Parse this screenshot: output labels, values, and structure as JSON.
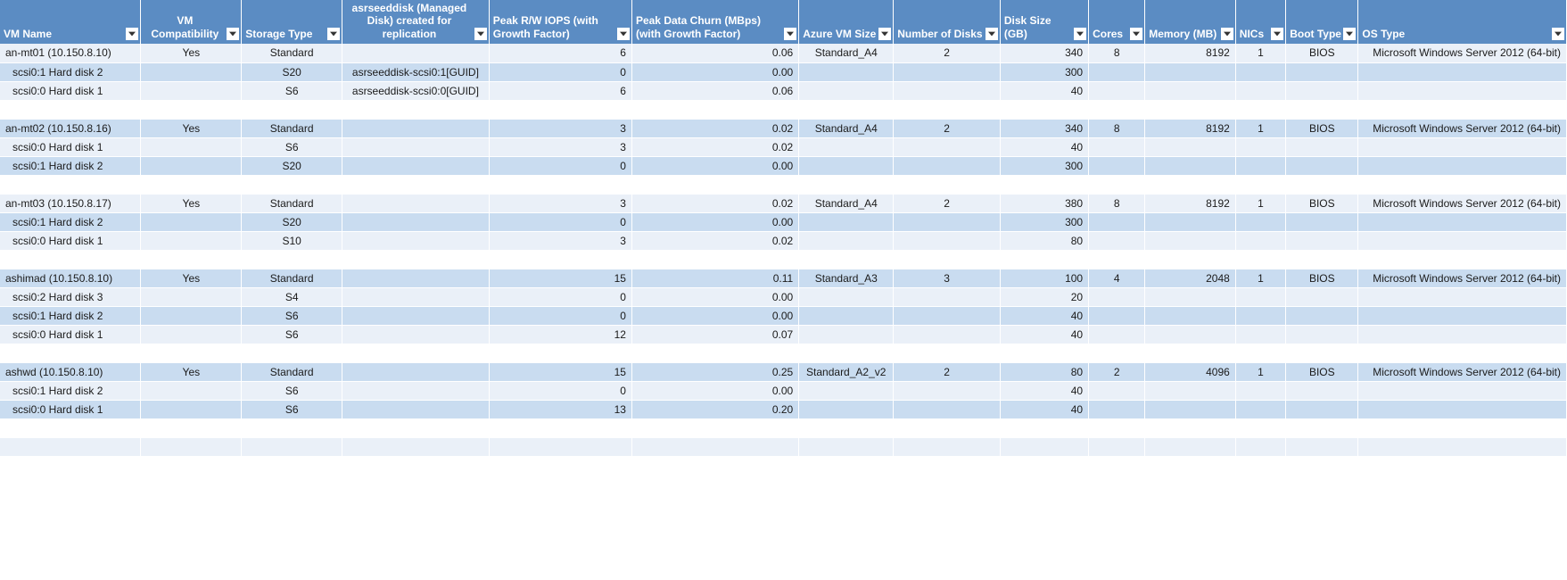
{
  "columns": [
    {
      "label": "VM Name",
      "align": "left"
    },
    {
      "label": "VM Compatibility",
      "align": "center"
    },
    {
      "label": "Storage Type",
      "align": "center"
    },
    {
      "label": "asrseeddisk (Managed Disk) created for replication",
      "align": "center"
    },
    {
      "label": "Peak R/W IOPS (with Growth Factor)",
      "align": "right"
    },
    {
      "label": "Peak Data Churn (MBps) (with Growth Factor)",
      "align": "right"
    },
    {
      "label": "Azure VM Size",
      "align": "center"
    },
    {
      "label": "Number of Disks",
      "align": "center"
    },
    {
      "label": "Disk Size (GB)",
      "align": "right"
    },
    {
      "label": "Cores",
      "align": "center"
    },
    {
      "label": "Memory (MB)",
      "align": "right"
    },
    {
      "label": "NICs",
      "align": "center"
    },
    {
      "label": "Boot Type",
      "align": "center"
    },
    {
      "label": "OS Type",
      "align": "right"
    }
  ],
  "rows": [
    {
      "band": "light",
      "cells": [
        "an-mt01 (10.150.8.10)",
        "Yes",
        "Standard",
        "",
        "6",
        "0.06",
        "Standard_A4",
        "2",
        "340",
        "8",
        "8192",
        "1",
        "BIOS",
        "Microsoft Windows Server 2012 (64-bit)"
      ]
    },
    {
      "band": "dark",
      "indent": true,
      "cells": [
        "scsi0:1 Hard disk 2",
        "",
        "S20",
        "asrseeddisk-scsi0:1[GUID]",
        "0",
        "0.00",
        "",
        "",
        "300",
        "",
        "",
        "",
        "",
        ""
      ]
    },
    {
      "band": "light",
      "indent": true,
      "cells": [
        "scsi0:0 Hard disk 1",
        "",
        "S6",
        "asrseeddisk-scsi0:0[GUID]",
        "6",
        "0.06",
        "",
        "",
        "40",
        "",
        "",
        "",
        "",
        ""
      ]
    },
    {
      "band": "spacer",
      "cells": [
        "",
        "",
        "",
        "",
        "",
        "",
        "",
        "",
        "",
        "",
        "",
        "",
        "",
        ""
      ]
    },
    {
      "band": "dark",
      "cells": [
        "an-mt02 (10.150.8.16)",
        "Yes",
        "Standard",
        "",
        "3",
        "0.02",
        "Standard_A4",
        "2",
        "340",
        "8",
        "8192",
        "1",
        "BIOS",
        "Microsoft Windows Server 2012 (64-bit)"
      ]
    },
    {
      "band": "light",
      "indent": true,
      "cells": [
        "scsi0:0 Hard disk 1",
        "",
        "S6",
        "",
        "3",
        "0.02",
        "",
        "",
        "40",
        "",
        "",
        "",
        "",
        ""
      ]
    },
    {
      "band": "dark",
      "indent": true,
      "cells": [
        "scsi0:1 Hard disk 2",
        "",
        "S20",
        "",
        "0",
        "0.00",
        "",
        "",
        "300",
        "",
        "",
        "",
        "",
        ""
      ]
    },
    {
      "band": "spacer",
      "cells": [
        "",
        "",
        "",
        "",
        "",
        "",
        "",
        "",
        "",
        "",
        "",
        "",
        "",
        ""
      ]
    },
    {
      "band": "light",
      "cells": [
        "an-mt03 (10.150.8.17)",
        "Yes",
        "Standard",
        "",
        "3",
        "0.02",
        "Standard_A4",
        "2",
        "380",
        "8",
        "8192",
        "1",
        "BIOS",
        "Microsoft Windows Server 2012 (64-bit)"
      ]
    },
    {
      "band": "dark",
      "indent": true,
      "cells": [
        "scsi0:1 Hard disk 2",
        "",
        "S20",
        "",
        "0",
        "0.00",
        "",
        "",
        "300",
        "",
        "",
        "",
        "",
        ""
      ]
    },
    {
      "band": "light",
      "indent": true,
      "cells": [
        "scsi0:0 Hard disk 1",
        "",
        "S10",
        "",
        "3",
        "0.02",
        "",
        "",
        "80",
        "",
        "",
        "",
        "",
        ""
      ]
    },
    {
      "band": "spacer",
      "cells": [
        "",
        "",
        "",
        "",
        "",
        "",
        "",
        "",
        "",
        "",
        "",
        "",
        "",
        ""
      ]
    },
    {
      "band": "dark",
      "cells": [
        "ashimad (10.150.8.10)",
        "Yes",
        "Standard",
        "",
        "15",
        "0.11",
        "Standard_A3",
        "3",
        "100",
        "4",
        "2048",
        "1",
        "BIOS",
        "Microsoft Windows Server 2012 (64-bit)"
      ]
    },
    {
      "band": "light",
      "indent": true,
      "cells": [
        "scsi0:2 Hard disk 3",
        "",
        "S4",
        "",
        "0",
        "0.00",
        "",
        "",
        "20",
        "",
        "",
        "",
        "",
        ""
      ]
    },
    {
      "band": "dark",
      "indent": true,
      "cells": [
        "scsi0:1 Hard disk 2",
        "",
        "S6",
        "",
        "0",
        "0.00",
        "",
        "",
        "40",
        "",
        "",
        "",
        "",
        ""
      ]
    },
    {
      "band": "light",
      "indent": true,
      "cells": [
        "scsi0:0 Hard disk 1",
        "",
        "S6",
        "",
        "12",
        "0.07",
        "",
        "",
        "40",
        "",
        "",
        "",
        "",
        ""
      ]
    },
    {
      "band": "spacer",
      "cells": [
        "",
        "",
        "",
        "",
        "",
        "",
        "",
        "",
        "",
        "",
        "",
        "",
        "",
        ""
      ]
    },
    {
      "band": "dark",
      "cells": [
        "ashwd (10.150.8.10)",
        "Yes",
        "Standard",
        "",
        "15",
        "0.25",
        "Standard_A2_v2",
        "2",
        "80",
        "2",
        "4096",
        "1",
        "BIOS",
        "Microsoft Windows Server 2012 (64-bit)"
      ]
    },
    {
      "band": "light",
      "indent": true,
      "cells": [
        "scsi0:1 Hard disk 2",
        "",
        "S6",
        "",
        "0",
        "0.00",
        "",
        "",
        "40",
        "",
        "",
        "",
        "",
        ""
      ]
    },
    {
      "band": "dark",
      "indent": true,
      "cells": [
        "scsi0:0 Hard disk 1",
        "",
        "S6",
        "",
        "13",
        "0.20",
        "",
        "",
        "40",
        "",
        "",
        "",
        "",
        ""
      ]
    },
    {
      "band": "spacer",
      "cells": [
        "",
        "",
        "",
        "",
        "",
        "",
        "",
        "",
        "",
        "",
        "",
        "",
        "",
        ""
      ]
    },
    {
      "band": "light",
      "cells": [
        "",
        "",
        "",
        "",
        "",
        "",
        "",
        "",
        "",
        "",
        "",
        "",
        "",
        ""
      ]
    }
  ]
}
